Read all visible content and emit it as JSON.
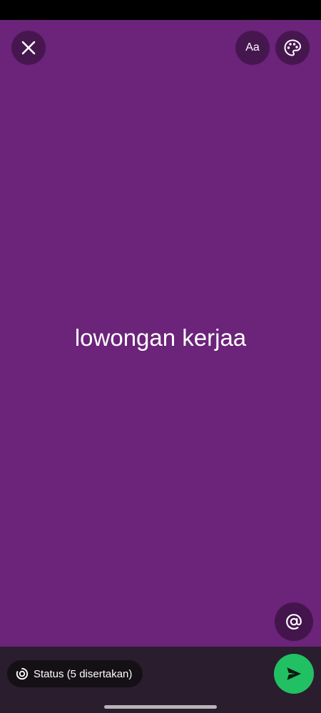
{
  "colors": {
    "background": "#6b2479",
    "send_button": "#21c063",
    "bottom_bar": "#2a1d2d",
    "text": "#ffffff"
  },
  "toolbar": {
    "close_icon": "close-icon",
    "text_style_label": "Aa",
    "palette_icon": "palette-icon"
  },
  "canvas": {
    "status_text": "lowongan kerjaa",
    "mention_icon": "at-sign-icon"
  },
  "footer": {
    "audience_label": "Status (5 disertakan)",
    "audience_icon": "status-ring-icon",
    "send_icon": "send-icon"
  }
}
